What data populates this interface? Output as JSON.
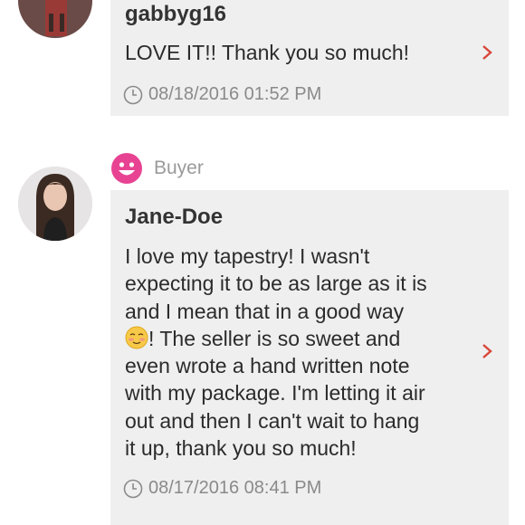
{
  "reviews": [
    {
      "username": "gabbyg16",
      "text": "LOVE IT!! Thank you so much!",
      "timestamp": "08/18/2016 01:52 PM"
    },
    {
      "role": "Buyer",
      "username": "Jane-Doe",
      "lines": [
        "I love my tapestry! I wasn't",
        "expecting it to be as large as it is",
        "and I mean that in a good way",
        "! The seller is so sweet and",
        "even wrote a hand written note",
        "with my package. I'm letting it air",
        "out and then I can't wait to hang",
        "it up, thank you so much!"
      ],
      "timestamp": "08/17/2016 08:41 PM"
    }
  ],
  "colors": {
    "accent": "#e84393",
    "chevron": "#d9463a",
    "card": "#efefef"
  }
}
